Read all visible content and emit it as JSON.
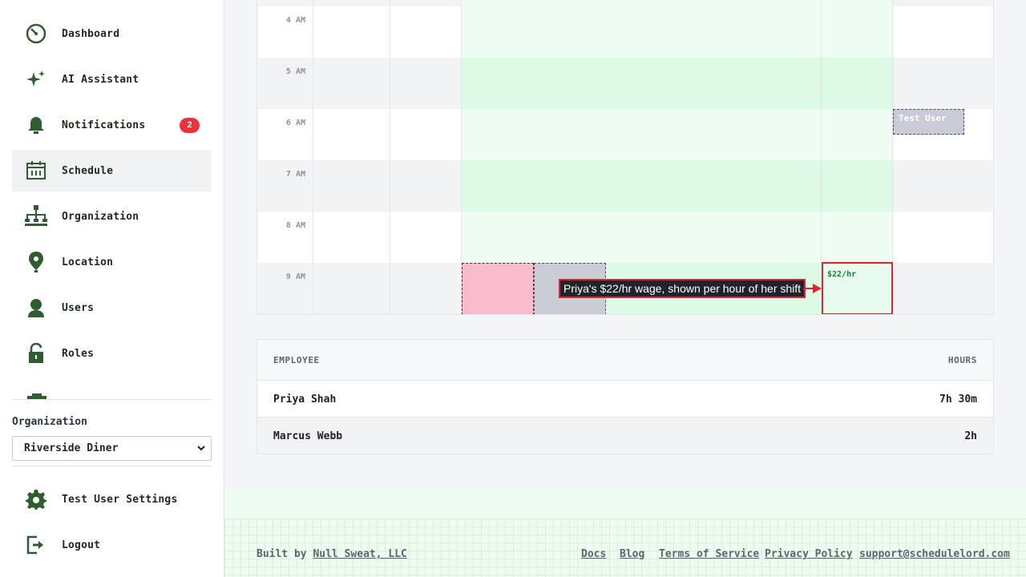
{
  "sidebar": {
    "items": [
      {
        "label": "Dashboard",
        "icon": "dashboard-icon"
      },
      {
        "label": "AI Assistant",
        "icon": "sparkle-icon"
      },
      {
        "label": "Notifications",
        "icon": "bell-icon",
        "badge": "2"
      },
      {
        "label": "Schedule",
        "icon": "calendar-icon",
        "active": true
      },
      {
        "label": "Organization",
        "icon": "org-tree-icon"
      },
      {
        "label": "Location",
        "icon": "map-pin-icon"
      },
      {
        "label": "Users",
        "icon": "user-icon"
      },
      {
        "label": "Roles",
        "icon": "lock-icon"
      }
    ],
    "organization_label": "Organization",
    "organization_selected": "Riverside Diner",
    "settings_label": "Test User Settings",
    "logout_label": "Logout"
  },
  "calendar": {
    "hours": [
      "4 AM",
      "5 AM",
      "6 AM",
      "7 AM",
      "8 AM",
      "9 AM"
    ],
    "events": {
      "test_user": "Test User",
      "wage": "$22/hr"
    },
    "callout": "Priya's $22/hr wage, shown per hour of her shift"
  },
  "table": {
    "headers": {
      "employee": "EMPLOYEE",
      "hours": "HOURS"
    },
    "rows": [
      {
        "employee": "Priya Shah",
        "hours": "7h 30m"
      },
      {
        "employee": "Marcus Webb",
        "hours": "2h"
      }
    ]
  },
  "footer": {
    "built_by_prefix": "Built by",
    "built_by_link": "Null Sweat, LLC",
    "links": [
      "Docs",
      "Blog",
      "Terms of Service",
      "Privacy Policy",
      "support@schedulelord.com"
    ]
  },
  "colors": {
    "accent_green": "#2f5d2f",
    "availability_green": "#dcfae6",
    "badge_red": "#e8323c",
    "highlight_red": "#e0242c"
  }
}
